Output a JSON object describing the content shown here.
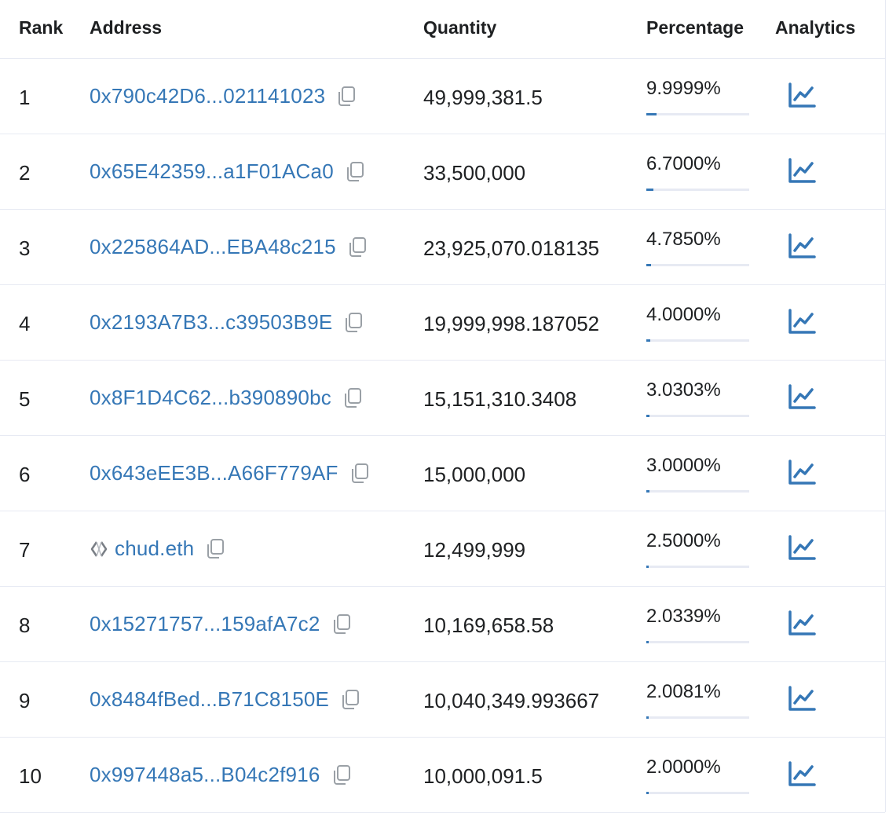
{
  "table": {
    "headers": {
      "rank": "Rank",
      "address": "Address",
      "quantity": "Quantity",
      "percentage": "Percentage",
      "analytics": "Analytics"
    },
    "rows": [
      {
        "rank": "1",
        "address": "0x790c42D6...021141023",
        "quantity": "49,999,381.5",
        "percentage": "9.9999%",
        "fill": 0.099999,
        "ens": false
      },
      {
        "rank": "2",
        "address": "0x65E42359...a1F01ACa0",
        "quantity": "33,500,000",
        "percentage": "6.7000%",
        "fill": 0.067,
        "ens": false
      },
      {
        "rank": "3",
        "address": "0x225864AD...EBA48c215",
        "quantity": "23,925,070.018135",
        "percentage": "4.7850%",
        "fill": 0.04785,
        "ens": false
      },
      {
        "rank": "4",
        "address": "0x2193A7B3...c39503B9E",
        "quantity": "19,999,998.187052",
        "percentage": "4.0000%",
        "fill": 0.04,
        "ens": false
      },
      {
        "rank": "5",
        "address": "0x8F1D4C62...b390890bc",
        "quantity": "15,151,310.3408",
        "percentage": "3.0303%",
        "fill": 0.030303,
        "ens": false
      },
      {
        "rank": "6",
        "address": "0x643eEE3B...A66F779AF",
        "quantity": "15,000,000",
        "percentage": "3.0000%",
        "fill": 0.03,
        "ens": false
      },
      {
        "rank": "7",
        "address": "chud.eth",
        "quantity": "12,499,999",
        "percentage": "2.5000%",
        "fill": 0.025,
        "ens": true
      },
      {
        "rank": "8",
        "address": "0x15271757...159afA7c2",
        "quantity": "10,169,658.58",
        "percentage": "2.0339%",
        "fill": 0.020339,
        "ens": false
      },
      {
        "rank": "9",
        "address": "0x8484fBed...B71C8150E",
        "quantity": "10,040,349.993667",
        "percentage": "2.0081%",
        "fill": 0.020081,
        "ens": false
      },
      {
        "rank": "10",
        "address": "0x997448a5...B04c2f916",
        "quantity": "10,000,091.5",
        "percentage": "2.0000%",
        "fill": 0.02,
        "ens": false
      }
    ]
  },
  "icons": {
    "copy": "copy-icon",
    "analytics": "chart-line-icon",
    "ens": "ens-logo-icon"
  },
  "colors": {
    "link": "#3577b6",
    "text": "#1e2022",
    "border": "#e7eaf3",
    "copy_icon": "#9aa0a6"
  }
}
